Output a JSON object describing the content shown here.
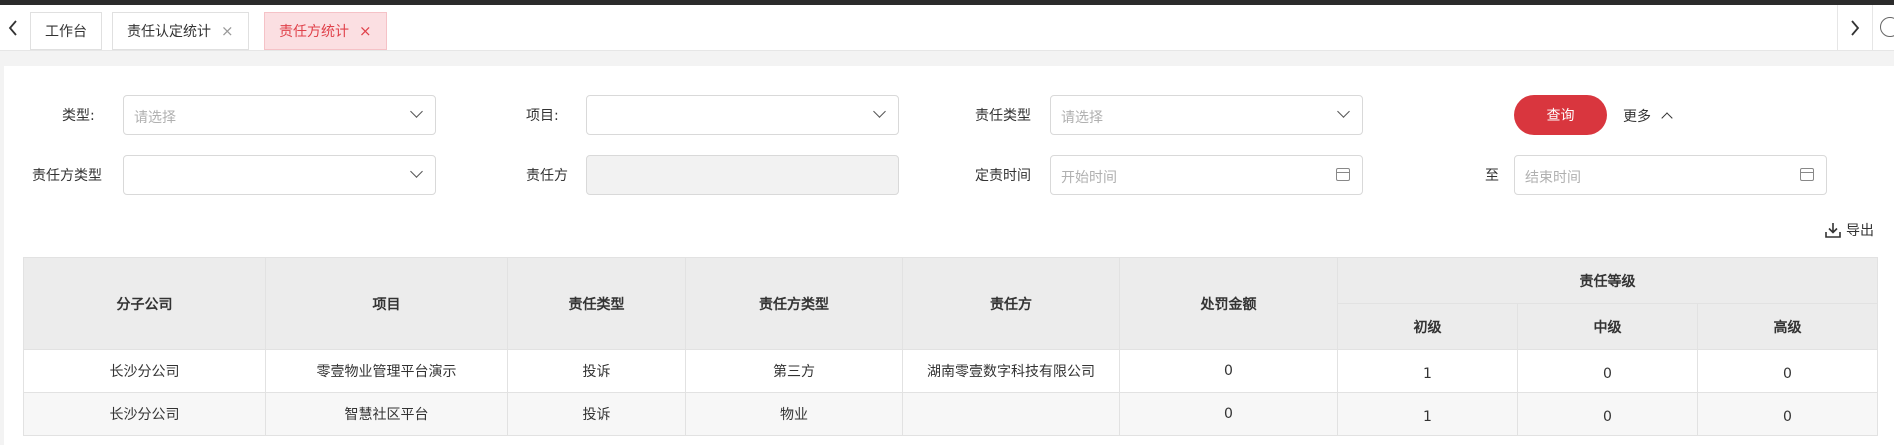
{
  "tabs": {
    "items": [
      {
        "label": "工作台",
        "closable": false
      },
      {
        "label": "责任认定统计",
        "closable": true
      },
      {
        "label": "责任方统计",
        "closable": true,
        "active": true
      }
    ],
    "close_symbol": "×"
  },
  "filters": {
    "type_label": "类型:",
    "type_placeholder": "请选择",
    "project_label": "项目:",
    "project_value": "",
    "duty_type_label": "责任类型",
    "duty_type_placeholder": "请选择",
    "party_type_label": "责任方类型",
    "party_type_value": "",
    "party_label": "责任方",
    "party_value": "",
    "time_label": "定责时间",
    "start_placeholder": "开始时间",
    "to_label": "至",
    "end_placeholder": "结束时间"
  },
  "actions": {
    "query_label": "查询",
    "more_label": "更多",
    "export_label": "导出"
  },
  "table": {
    "headers": {
      "company": "分子公司",
      "project": "项目",
      "duty_type": "责任类型",
      "party_type": "责任方类型",
      "party": "责任方",
      "penalty": "处罚金额",
      "level": "责任等级",
      "level_low": "初级",
      "level_mid": "中级",
      "level_high": "高级"
    },
    "rows": [
      {
        "company": "长沙分公司",
        "project": "零壹物业管理平台演示",
        "duty_type": "投诉",
        "party_type": "第三方",
        "party": "湖南零壹数字科技有限公司",
        "penalty": "0",
        "low": "1",
        "mid": "0",
        "high": "0"
      },
      {
        "company": "长沙分公司",
        "project": "智慧社区平台",
        "duty_type": "投诉",
        "party_type": "物业",
        "party": "",
        "penalty": "0",
        "low": "1",
        "mid": "0",
        "high": "0"
      }
    ]
  },
  "colors": {
    "accent": "#d9363e",
    "active_tab_bg": "#fbdfe2",
    "active_tab_text": "#e0414a"
  }
}
